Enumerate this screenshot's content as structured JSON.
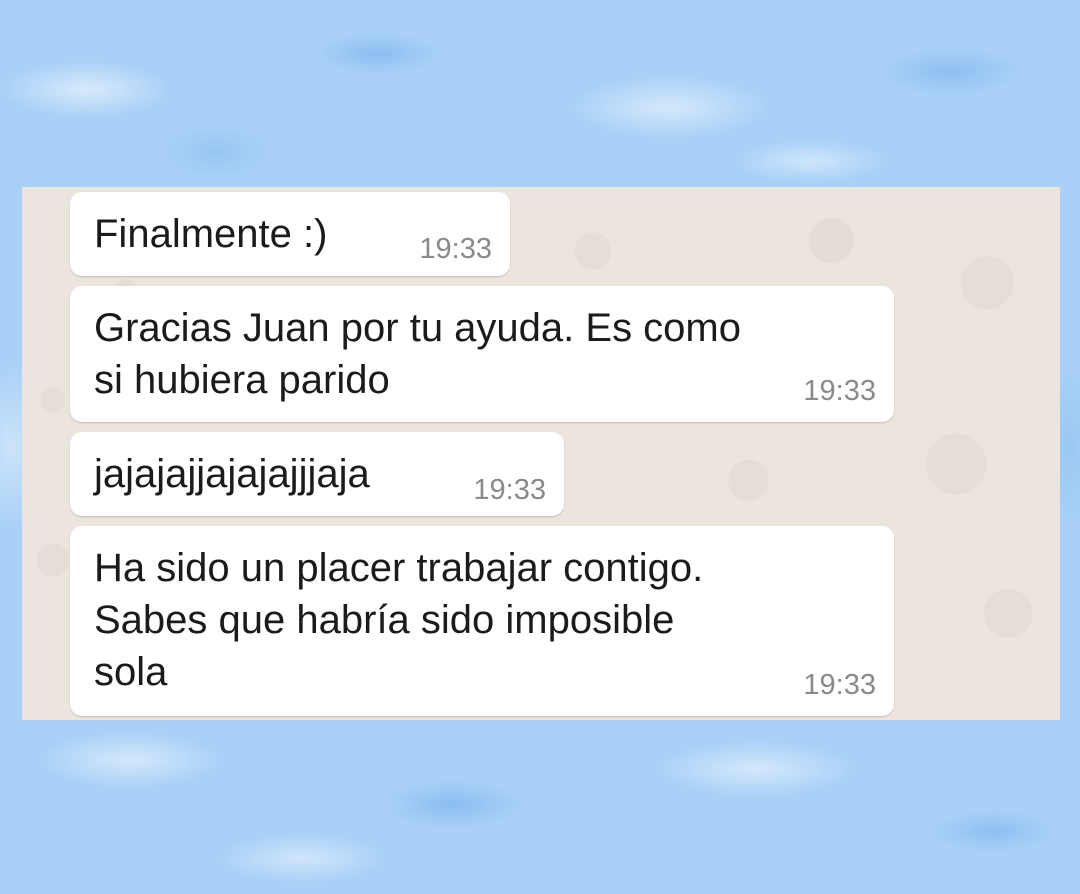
{
  "messages": [
    {
      "text": "Finalmente :)",
      "time": "19:33"
    },
    {
      "text": "Gracias Juan por tu ayuda. Es como\nsi hubiera parido",
      "time": "19:33"
    },
    {
      "text": "jajajajjajajajjjaja",
      "time": "19:33"
    },
    {
      "text": "Ha sido un placer trabajar contigo.\nSabes que habría sido imposible\nsola",
      "time": "19:33"
    }
  ],
  "colors": {
    "outer_background": "#a9d1f7",
    "chat_background": "#ece5dd",
    "bubble": "#ffffff",
    "time_text": "#8a8a8a"
  }
}
